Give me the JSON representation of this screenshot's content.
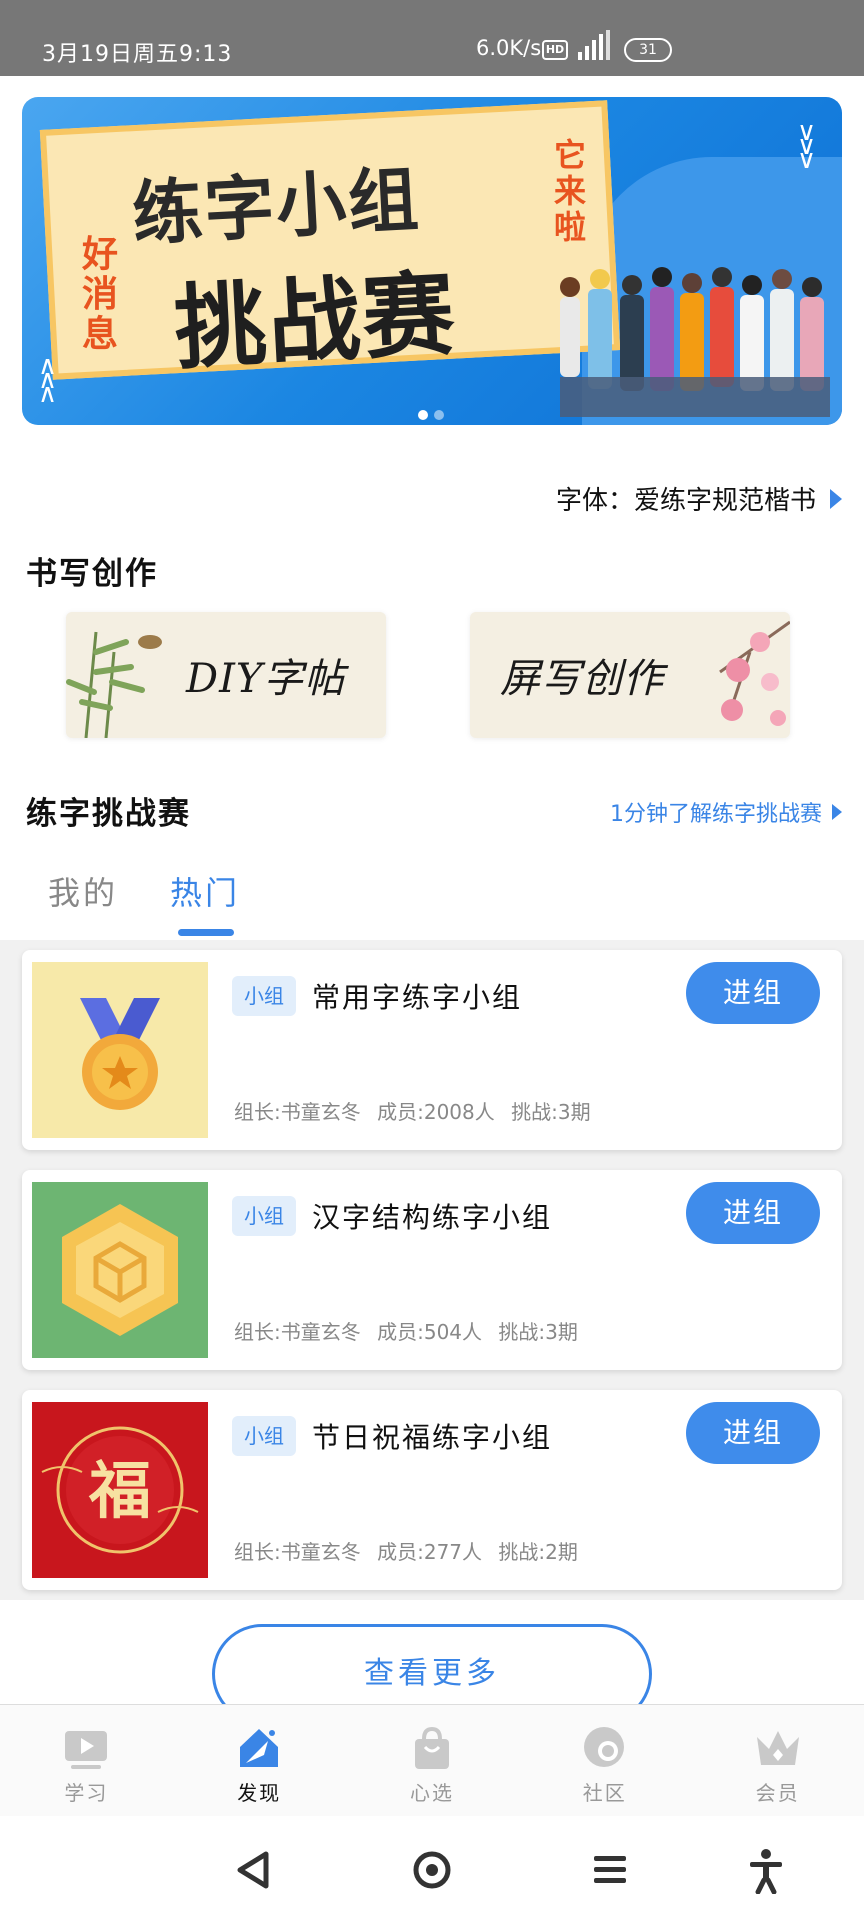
{
  "status_bar": {
    "time": "3月19日周五9:13",
    "network_speed": "6.0K/s",
    "hd": "HD",
    "battery": "31"
  },
  "banner": {
    "line1": "练字小组",
    "line2": "挑战赛",
    "tag_left": "好消息",
    "tag_right": "它来啦",
    "dots": 2,
    "active_dot": 0
  },
  "font_setting": "字体：爱练字规范楷书",
  "writing": {
    "title": "书写创作",
    "cards": [
      {
        "label": "DIY字帖"
      },
      {
        "label": "屏写创作"
      }
    ]
  },
  "challenge": {
    "title": "练字挑战赛",
    "link": "1分钟了解练字挑战赛",
    "tabs": [
      {
        "label": "我的"
      },
      {
        "label": "热门"
      }
    ],
    "active_tab": 1,
    "groups": [
      {
        "badge": "小组",
        "name": "常用字练字小组",
        "leader": "组长:书童玄冬",
        "members": "成员:2008人",
        "period": "挑战:3期",
        "join": "进组",
        "icon": "medal-icon"
      },
      {
        "badge": "小组",
        "name": "汉字结构练字小组",
        "leader": "组长:书童玄冬",
        "members": "成员:504人",
        "period": "挑战:3期",
        "join": "进组",
        "icon": "cube-icon"
      },
      {
        "badge": "小组",
        "name": "节日祝福练字小组",
        "leader": "组长:书童玄冬",
        "members": "成员:277人",
        "period": "挑战:2期",
        "join": "进组",
        "icon": "fu-icon",
        "fu": "福"
      }
    ],
    "more": "查看更多"
  },
  "bottom_nav": [
    {
      "label": "学习",
      "icon": "play-icon"
    },
    {
      "label": "发现",
      "icon": "discover-icon"
    },
    {
      "label": "心选",
      "icon": "bag-icon"
    },
    {
      "label": "社区",
      "icon": "community-icon"
    },
    {
      "label": "会员",
      "icon": "crown-icon"
    }
  ],
  "active_nav": 1,
  "colors": {
    "accent": "#3a85e6",
    "status_bar": "#777777",
    "banner_blue": "#1b86e2"
  }
}
